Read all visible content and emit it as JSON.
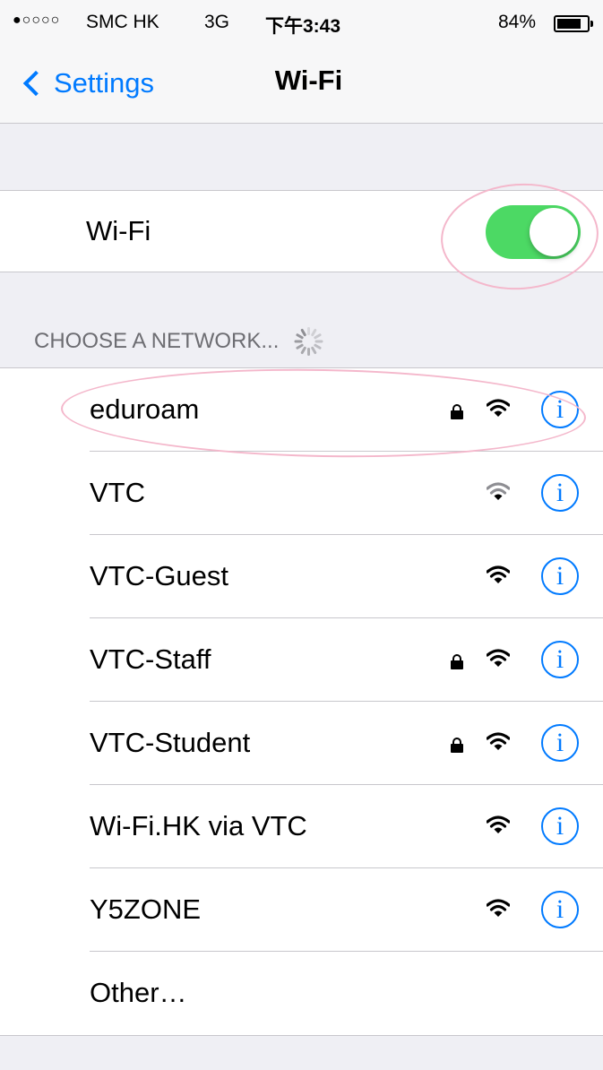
{
  "status_bar": {
    "signal": "●○○○○",
    "carrier": "SMC HK",
    "network_type": "3G",
    "time": "下午3:43",
    "battery": "84%"
  },
  "nav": {
    "back_label": "Settings",
    "title": "Wi-Fi"
  },
  "wifi_toggle": {
    "label": "Wi-Fi",
    "on": true
  },
  "section_header": "CHOOSE A NETWORK...",
  "networks": [
    {
      "name": "eduroam",
      "secured": true,
      "signal": "strong"
    },
    {
      "name": "VTC",
      "secured": false,
      "signal": "weak"
    },
    {
      "name": "VTC-Guest",
      "secured": false,
      "signal": "strong"
    },
    {
      "name": "VTC-Staff",
      "secured": true,
      "signal": "strong"
    },
    {
      "name": "VTC-Student",
      "secured": true,
      "signal": "strong"
    },
    {
      "name": "Wi-Fi.HK via VTC",
      "secured": false,
      "signal": "strong"
    },
    {
      "name": "Y5ZONE",
      "secured": false,
      "signal": "strong"
    }
  ],
  "other_label": "Other…",
  "info_glyph": "i",
  "colors": {
    "accent": "#007aff",
    "toggle_on": "#4cd964",
    "annotation": "#f4b7cb"
  }
}
